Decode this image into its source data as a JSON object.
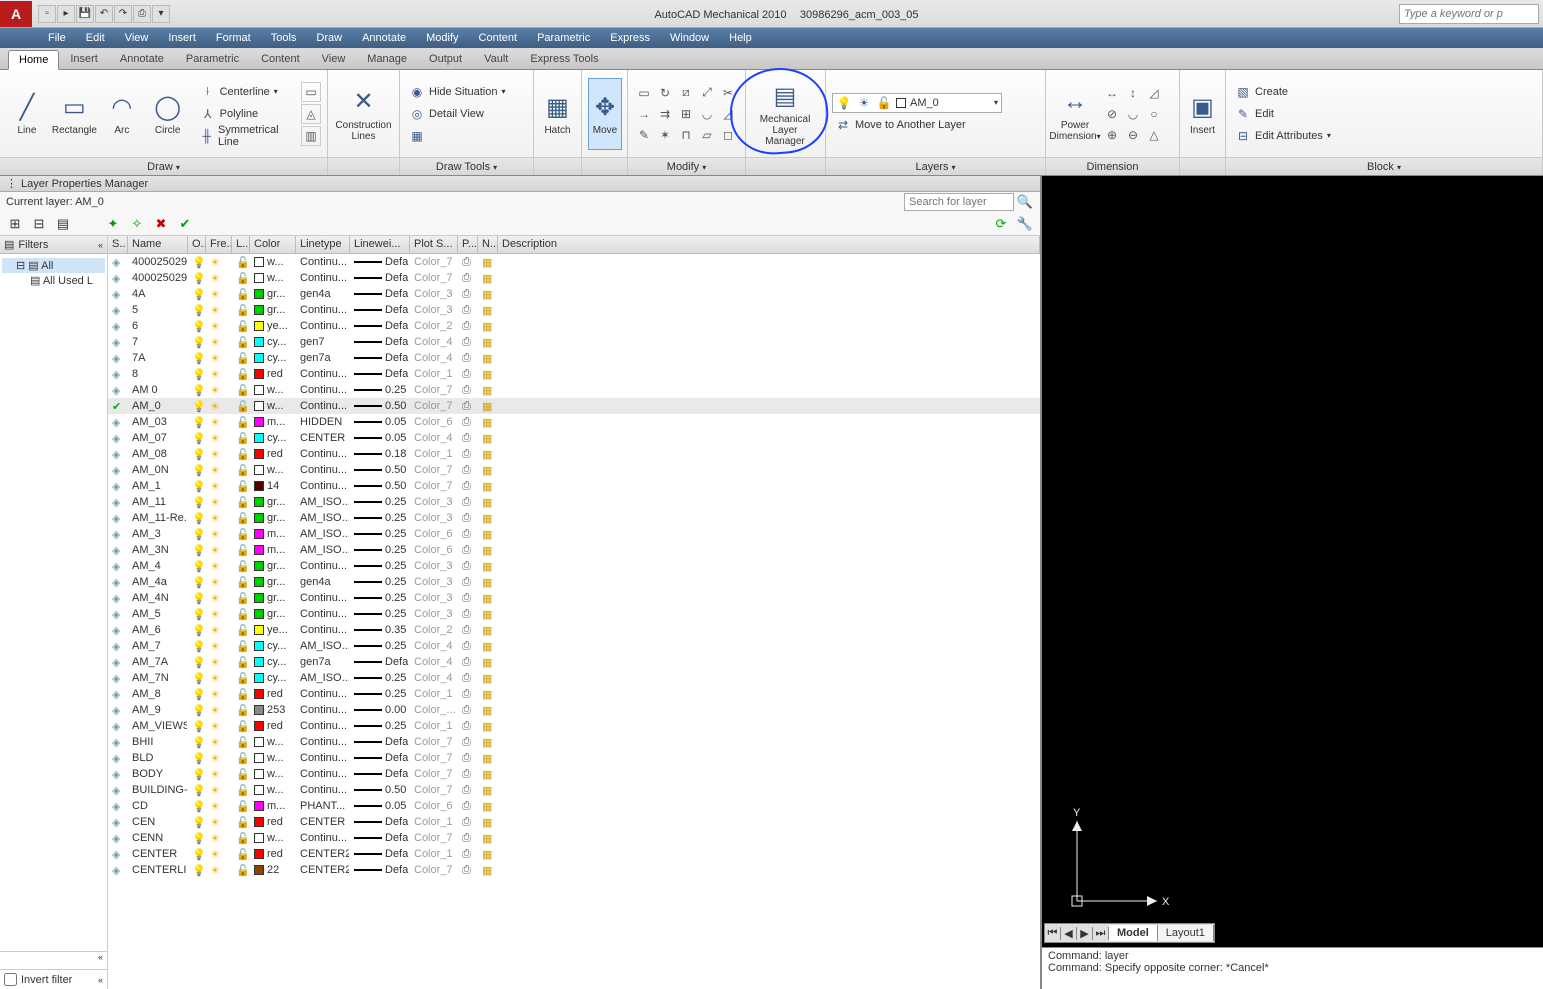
{
  "title": {
    "app": "AutoCAD Mechanical 2010",
    "doc": "30986296_acm_003_05"
  },
  "keyword_placeholder": "Type a keyword or p",
  "menus": [
    "File",
    "Edit",
    "View",
    "Insert",
    "Format",
    "Tools",
    "Draw",
    "Annotate",
    "Modify",
    "Content",
    "Parametric",
    "Express",
    "Window",
    "Help"
  ],
  "tabs": [
    "Home",
    "Insert",
    "Annotate",
    "Parametric",
    "Content",
    "View",
    "Manage",
    "Output",
    "Vault",
    "Express Tools"
  ],
  "ribbon": {
    "draw": {
      "title": "Draw",
      "big": [
        [
          "Line",
          "╱"
        ],
        [
          "Rectangle",
          "▭"
        ],
        [
          "Arc",
          "◠"
        ],
        [
          "Circle",
          "◯"
        ]
      ],
      "small": [
        "Centerline",
        "Polyline",
        "Symmetrical Line"
      ]
    },
    "construction": {
      "title": "",
      "big": [
        "Construction\nLines",
        "✕"
      ]
    },
    "drawtools": {
      "title": "Draw Tools",
      "items": [
        "Hide Situation",
        "Detail View"
      ]
    },
    "hatch": {
      "title": "",
      "big": [
        "Hatch",
        "▦"
      ]
    },
    "move": {
      "title": "",
      "big": [
        "Move",
        "✥"
      ]
    },
    "modify": {
      "title": "Modify"
    },
    "mlm": {
      "big": [
        "Mechanical\nLayer Manager",
        "▤"
      ]
    },
    "layers": {
      "title": "Layers",
      "current": "AM_0",
      "move_layer": "Move to Another Layer"
    },
    "dim": {
      "title": "Dimension",
      "big": [
        "Power\nDimension",
        "↔"
      ]
    },
    "insert": {
      "title": "",
      "big": [
        "Insert",
        "▣"
      ]
    },
    "block": {
      "title": "Block",
      "items": [
        "Create",
        "Edit",
        "Edit Attributes"
      ]
    }
  },
  "lpm": {
    "title": "Layer Properties Manager",
    "current": "Current layer: AM_0",
    "search_placeholder": "Search for layer",
    "filters_hdr": "Filters",
    "tree": [
      "All",
      "All Used L"
    ],
    "invert": "Invert filter",
    "cols": [
      "S..",
      "Name",
      "O..",
      "Fre...",
      "L...",
      "Color",
      "Linetype",
      "Linewei...",
      "Plot S...",
      "P...",
      "N..",
      "Description"
    ],
    "rows": [
      {
        "n": "400025029...",
        "c": "#fff",
        "cn": "w...",
        "lt": "Continu...",
        "lw": "Defa...",
        "ps": "Color_7"
      },
      {
        "n": "400025029...",
        "c": "#fff",
        "cn": "w...",
        "lt": "Continu...",
        "lw": "Defa...",
        "ps": "Color_7"
      },
      {
        "n": "4A",
        "c": "#0c0",
        "cn": "gr...",
        "lt": "gen4a",
        "lw": "Defa...",
        "ps": "Color_3"
      },
      {
        "n": "5",
        "c": "#0c0",
        "cn": "gr...",
        "lt": "Continu...",
        "lw": "Defa...",
        "ps": "Color_3"
      },
      {
        "n": "6",
        "c": "#ff0",
        "cn": "ye...",
        "lt": "Continu...",
        "lw": "Defa...",
        "ps": "Color_2"
      },
      {
        "n": "7",
        "c": "#0ff",
        "cn": "cy...",
        "lt": "gen7",
        "lw": "Defa...",
        "ps": "Color_4"
      },
      {
        "n": "7A",
        "c": "#0ff",
        "cn": "cy...",
        "lt": "gen7a",
        "lw": "Defa...",
        "ps": "Color_4"
      },
      {
        "n": "8",
        "c": "#f00",
        "cn": "red",
        "lt": "Continu...",
        "lw": "Defa...",
        "ps": "Color_1"
      },
      {
        "n": "AM 0",
        "c": "#fff",
        "cn": "w...",
        "lt": "Continu...",
        "lw": "0.25 ...",
        "ps": "Color_7"
      },
      {
        "n": "AM_0",
        "c": "#fff",
        "cn": "w...",
        "lt": "Continu...",
        "lw": "0.50 ...",
        "ps": "Color_7",
        "cur": true
      },
      {
        "n": "AM_03",
        "c": "#f0f",
        "cn": "m...",
        "lt": "HIDDEN",
        "lw": "0.05 ...",
        "ps": "Color_6"
      },
      {
        "n": "AM_07",
        "c": "#0ff",
        "cn": "cy...",
        "lt": "CENTER",
        "lw": "0.05 ...",
        "ps": "Color_4"
      },
      {
        "n": "AM_08",
        "c": "#f00",
        "cn": "red",
        "lt": "Continu...",
        "lw": "0.18 ...",
        "ps": "Color_1"
      },
      {
        "n": "AM_0N",
        "c": "#fff",
        "cn": "w...",
        "lt": "Continu...",
        "lw": "0.50 ...",
        "ps": "Color_7"
      },
      {
        "n": "AM_1",
        "c": "#500",
        "cn": "14",
        "lt": "Continu...",
        "lw": "0.50 ...",
        "ps": "Color_7"
      },
      {
        "n": "AM_11",
        "c": "#0c0",
        "cn": "gr...",
        "lt": "AM_ISO...",
        "lw": "0.25 ...",
        "ps": "Color_3"
      },
      {
        "n": "AM_11-Re...",
        "c": "#0c0",
        "cn": "gr...",
        "lt": "AM_ISO...",
        "lw": "0.25 ...",
        "ps": "Color_3"
      },
      {
        "n": "AM_3",
        "c": "#f0f",
        "cn": "m...",
        "lt": "AM_ISO...",
        "lw": "0.25 ...",
        "ps": "Color_6"
      },
      {
        "n": "AM_3N",
        "c": "#f0f",
        "cn": "m...",
        "lt": "AM_ISO...",
        "lw": "0.25 ...",
        "ps": "Color_6"
      },
      {
        "n": "AM_4",
        "c": "#0c0",
        "cn": "gr...",
        "lt": "Continu...",
        "lw": "0.25 ...",
        "ps": "Color_3"
      },
      {
        "n": "AM_4a",
        "c": "#0c0",
        "cn": "gr...",
        "lt": "gen4a",
        "lw": "0.25 ...",
        "ps": "Color_3"
      },
      {
        "n": "AM_4N",
        "c": "#0c0",
        "cn": "gr...",
        "lt": "Continu...",
        "lw": "0.25 ...",
        "ps": "Color_3"
      },
      {
        "n": "AM_5",
        "c": "#0c0",
        "cn": "gr...",
        "lt": "Continu...",
        "lw": "0.25 ...",
        "ps": "Color_3"
      },
      {
        "n": "AM_6",
        "c": "#ff0",
        "cn": "ye...",
        "lt": "Continu...",
        "lw": "0.35 ...",
        "ps": "Color_2"
      },
      {
        "n": "AM_7",
        "c": "#0ff",
        "cn": "cy...",
        "lt": "AM_ISO...",
        "lw": "0.25 ...",
        "ps": "Color_4"
      },
      {
        "n": "AM_7A",
        "c": "#0ff",
        "cn": "cy...",
        "lt": "gen7a",
        "lw": "Defa...",
        "ps": "Color_4"
      },
      {
        "n": "AM_7N",
        "c": "#0ff",
        "cn": "cy...",
        "lt": "AM_ISO...",
        "lw": "0.25 ...",
        "ps": "Color_4"
      },
      {
        "n": "AM_8",
        "c": "#f00",
        "cn": "red",
        "lt": "Continu...",
        "lw": "0.25 ...",
        "ps": "Color_1"
      },
      {
        "n": "AM_9",
        "c": "#888",
        "cn": "253",
        "lt": "Continu...",
        "lw": "0.00 ...",
        "ps": "Color_..."
      },
      {
        "n": "AM_VIEWS",
        "c": "#f00",
        "cn": "red",
        "lt": "Continu...",
        "lw": "0.25 ...",
        "ps": "Color_1"
      },
      {
        "n": "BHII",
        "c": "#fff",
        "cn": "w...",
        "lt": "Continu...",
        "lw": "Defa...",
        "ps": "Color_7"
      },
      {
        "n": "BLD",
        "c": "#fff",
        "cn": "w...",
        "lt": "Continu...",
        "lw": "Defa...",
        "ps": "Color_7"
      },
      {
        "n": "BODY",
        "c": "#fff",
        "cn": "w...",
        "lt": "Continu...",
        "lw": "Defa...",
        "ps": "Color_7"
      },
      {
        "n": "BUILDING-...",
        "c": "#fff",
        "cn": "w...",
        "lt": "Continu...",
        "lw": "0.50 ...",
        "ps": "Color_7"
      },
      {
        "n": "CD",
        "c": "#f0f",
        "cn": "m...",
        "lt": "PHANT...",
        "lw": "0.05 ...",
        "ps": "Color_6"
      },
      {
        "n": "CEN",
        "c": "#f00",
        "cn": "red",
        "lt": "CENTER",
        "lw": "Defa...",
        "ps": "Color_1"
      },
      {
        "n": "CENN",
        "c": "#fff",
        "cn": "w...",
        "lt": "Continu...",
        "lw": "Defa...",
        "ps": "Color_7"
      },
      {
        "n": "CENTER",
        "c": "#f00",
        "cn": "red",
        "lt": "CENTER2",
        "lw": "Defa...",
        "ps": "Color_1"
      },
      {
        "n": "CENTERLINE",
        "c": "#840",
        "cn": "22",
        "lt": "CENTER2",
        "lw": "Defa...",
        "ps": "Color_7"
      }
    ]
  },
  "layout": {
    "tabs": [
      "Model",
      "Layout1"
    ]
  },
  "cmd": [
    "Command: layer",
    "Command: Specify opposite corner: *Cancel*"
  ],
  "ucs": {
    "x": "X",
    "y": "Y"
  }
}
